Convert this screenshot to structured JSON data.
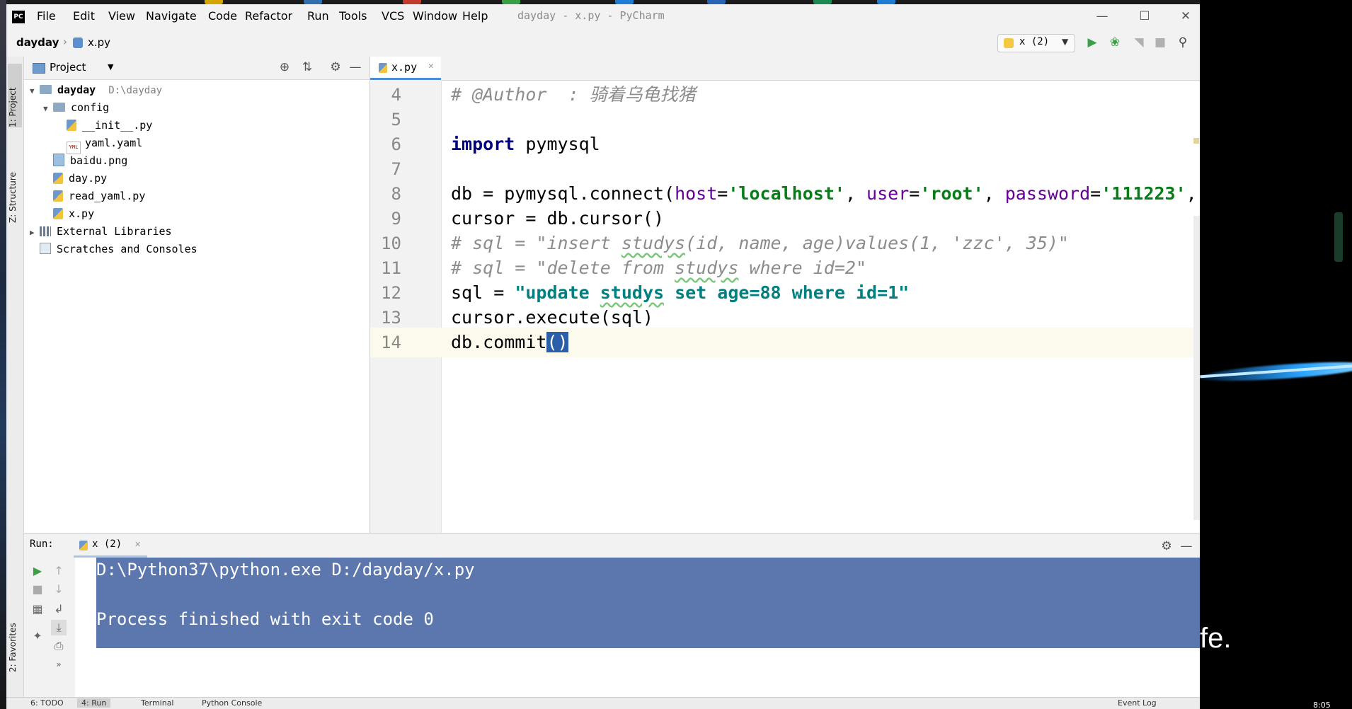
{
  "menu": {
    "items": [
      "File",
      "Edit",
      "View",
      "Navigate",
      "Code",
      "Refactor",
      "Run",
      "Tools",
      "VCS",
      "Window",
      "Help"
    ],
    "window_title": "dayday - x.py - PyCharm"
  },
  "nav": {
    "project": "dayday",
    "file": "x.py",
    "run_config": "x (2)"
  },
  "side_tabs": {
    "project": "1: Project",
    "structure": "Z: Structure",
    "favorites": "2: Favorites"
  },
  "project_panel": {
    "title": "Project",
    "tree": [
      {
        "label": "dayday",
        "hint": "D:\\dayday",
        "type": "folder",
        "depth": 0,
        "expanded": true
      },
      {
        "label": "config",
        "type": "folder",
        "depth": 1,
        "expanded": true
      },
      {
        "label": "__init__.py",
        "type": "py",
        "depth": 2
      },
      {
        "label": "yaml.yaml",
        "type": "yaml",
        "depth": 2
      },
      {
        "label": "baidu.png",
        "type": "png",
        "depth": 1
      },
      {
        "label": "day.py",
        "type": "py",
        "depth": 1
      },
      {
        "label": "read_yaml.py",
        "type": "py",
        "depth": 1
      },
      {
        "label": "x.py",
        "type": "py",
        "depth": 1
      },
      {
        "label": "External Libraries",
        "type": "lib",
        "depth": 0
      },
      {
        "label": "Scratches and Consoles",
        "type": "scratch",
        "depth": 0
      }
    ]
  },
  "editor": {
    "tab": "x.py",
    "lines": [
      {
        "n": "4",
        "text": "# @Author  : 骑着乌龟找猪"
      },
      {
        "n": "5",
        "text": ""
      },
      {
        "n": "6",
        "text": "import pymysql"
      },
      {
        "n": "7",
        "text": ""
      },
      {
        "n": "8",
        "text": "db = pymysql.connect(host='localhost', user='root', password='111223',"
      },
      {
        "n": "9",
        "text": "cursor = db.cursor()"
      },
      {
        "n": "10",
        "text": "# sql = \"insert studys(id, name, age)values(1, 'zzc', 35)\""
      },
      {
        "n": "11",
        "text": "# sql = \"delete from studys where id=2\""
      },
      {
        "n": "12",
        "text": "sql = \"update studys set age=88 where id=1\""
      },
      {
        "n": "13",
        "text": "cursor.execute(sql)"
      },
      {
        "n": "14",
        "text": "db.commit()"
      }
    ]
  },
  "run_panel": {
    "label": "Run:",
    "tab": "x (2)",
    "output": [
      "D:\\Python37\\python.exe D:/dayday/x.py",
      "",
      "Process finished with exit code 0"
    ]
  },
  "status_bar": {
    "items": [
      "6: TODO",
      "4: Run",
      "Terminal",
      "Python Console"
    ],
    "event_log": "Event Log"
  },
  "desktop": {
    "slogan": "fe.",
    "clock": "8:05"
  },
  "colors": {
    "console_bg": "#5b77ad",
    "keyword": "#000080",
    "string": "#067d17",
    "comment": "#8c8c8c",
    "param": "#660099"
  }
}
